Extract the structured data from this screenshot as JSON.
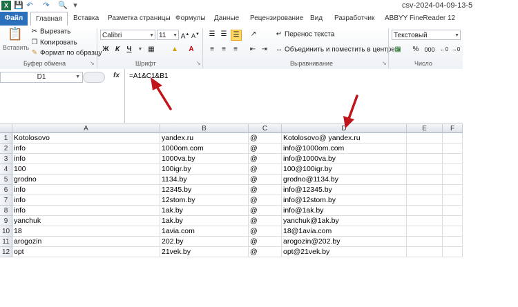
{
  "title_bar": {
    "doc_title": "csv-2024-04-09-13-5"
  },
  "tabs": [
    "Файл",
    "Главная",
    "Вставка",
    "Разметка страницы",
    "Формулы",
    "Данные",
    "Рецензирование",
    "Вид",
    "Разработчик",
    "ABBYY FineReader 12"
  ],
  "clipboard": {
    "paste": "Вставить",
    "cut": "Вырезать",
    "copy": "Копировать",
    "format_painter": "Формат по образцу",
    "label": "Буфер обмена"
  },
  "font": {
    "name": "Calibri",
    "size": "11",
    "bold": "Ж",
    "italic": "К",
    "underline": "Ч",
    "label": "Шрифт"
  },
  "alignment": {
    "wrap": "Перенос текста",
    "merge": "Объединить и поместить в центре",
    "label": "Выравнивание"
  },
  "number": {
    "format": "Текстовый",
    "percent": "%",
    "thousands": "000",
    "label": "Число"
  },
  "formula_bar": {
    "name_box": "D1",
    "fx": "fx",
    "formula": "=A1&C1&B1"
  },
  "columns": [
    "A",
    "B",
    "C",
    "D",
    "E",
    "F"
  ],
  "rows": [
    {
      "n": "1",
      "a": "Kotolosovo",
      "b": " yandex.ru",
      "c": "@",
      "d": "Kotolosovo@ yandex.ru"
    },
    {
      "n": "2",
      "a": "info",
      "b": "1000om.com",
      "c": "@",
      "d": "info@1000om.com"
    },
    {
      "n": "3",
      "a": "info",
      "b": "1000va.by",
      "c": "@",
      "d": "info@1000va.by"
    },
    {
      "n": "4",
      "a": "100",
      "b": "100igr.by",
      "c": "@",
      "d": "100@100igr.by"
    },
    {
      "n": "5",
      "a": "grodno",
      "b": "1134.by",
      "c": "@",
      "d": "grodno@1134.by"
    },
    {
      "n": "6",
      "a": "info",
      "b": "12345.by",
      "c": "@",
      "d": "info@12345.by"
    },
    {
      "n": "7",
      "a": "info",
      "b": "12stom.by",
      "c": "@",
      "d": "info@12stom.by"
    },
    {
      "n": "8",
      "a": "info",
      "b": "1ak.by",
      "c": "@",
      "d": "info@1ak.by"
    },
    {
      "n": "9",
      "a": "yanchuk",
      "b": "1ak.by",
      "c": "@",
      "d": "yanchuk@1ak.by"
    },
    {
      "n": "10",
      "a": "18",
      "b": "1avia.com",
      "c": "@",
      "d": "18@1avia.com"
    },
    {
      "n": "11",
      "a": "arogozin",
      "b": "202.by",
      "c": "@",
      "d": "arogozin@202.by"
    },
    {
      "n": "12",
      "a": "opt",
      "b": "21vek.by",
      "c": "@",
      "d": "opt@21vek.by"
    }
  ]
}
